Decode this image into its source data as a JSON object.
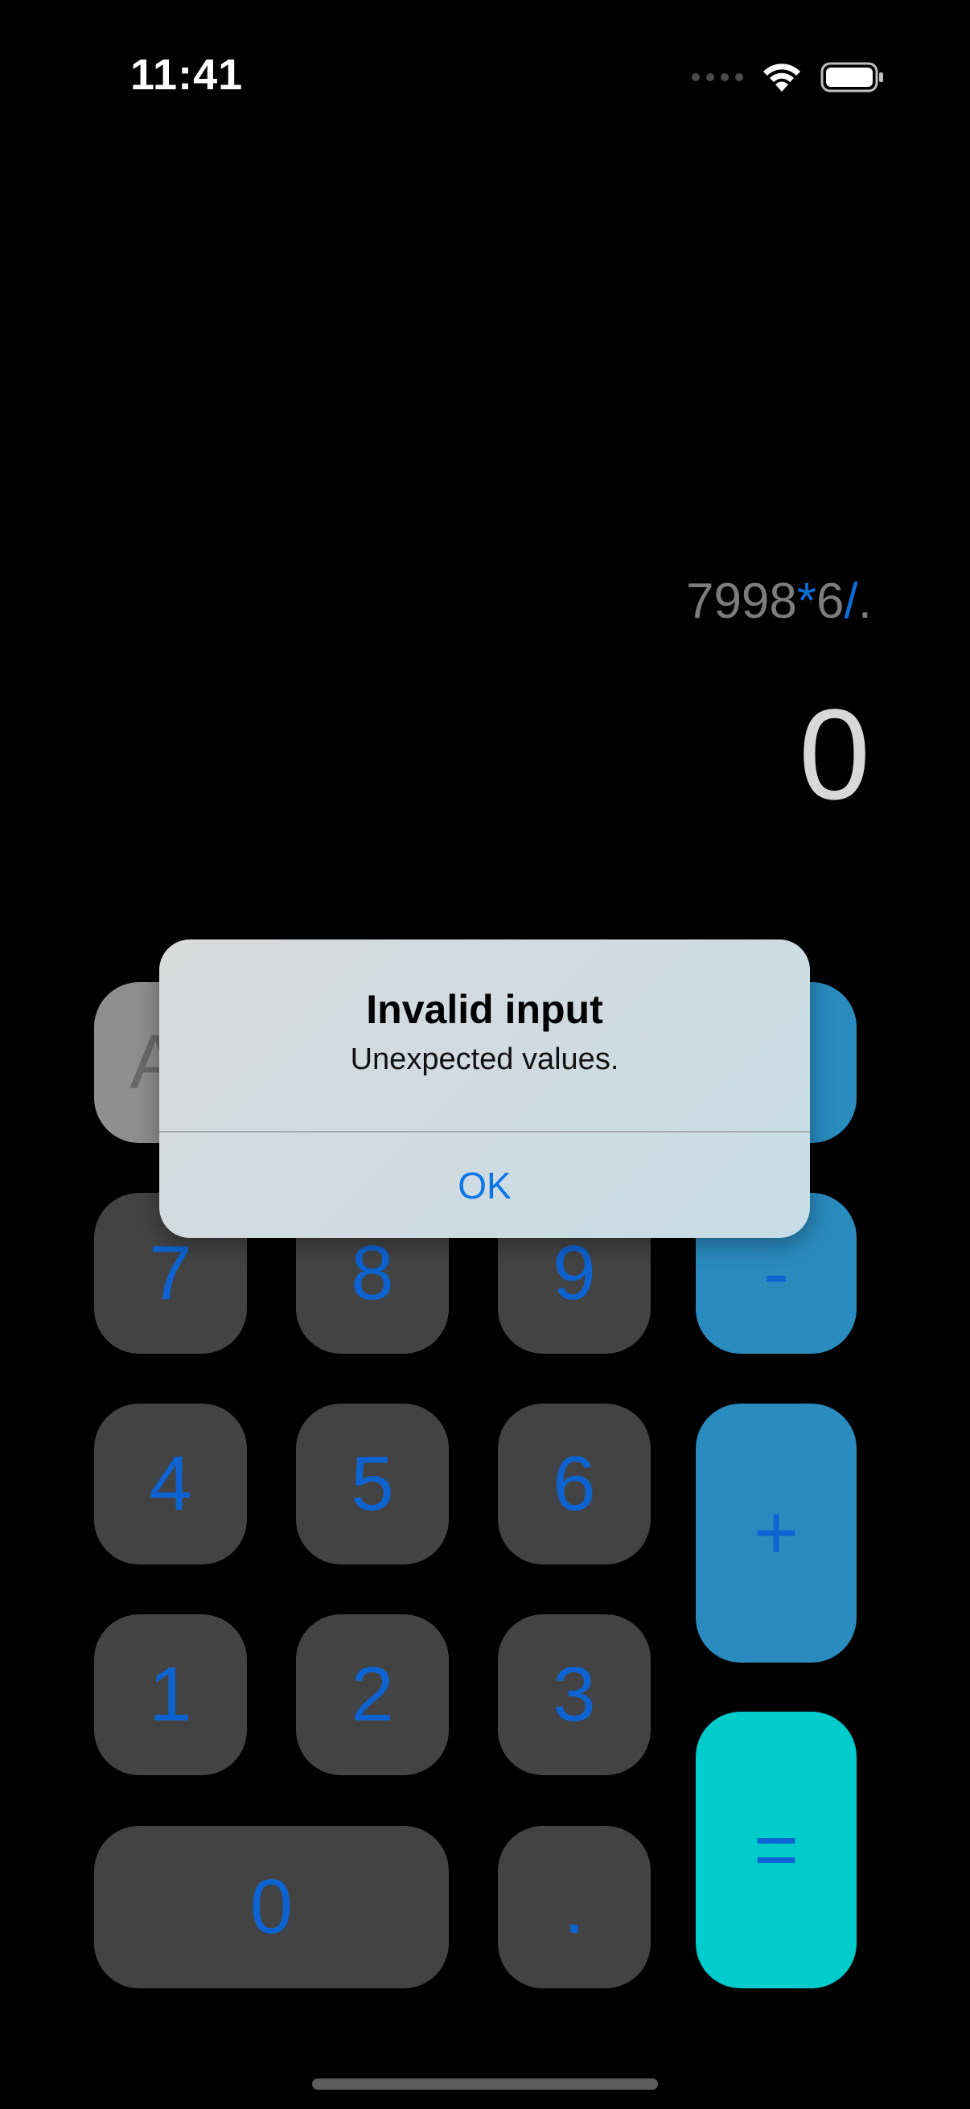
{
  "status_bar": {
    "time": "11:41",
    "icons": [
      "signal-dots-icon",
      "wifi-icon",
      "battery-icon"
    ]
  },
  "display": {
    "expression_parts": [
      "7998",
      "*",
      "6",
      "/",
      "."
    ],
    "result": "0"
  },
  "keypad": {
    "clear_label": "A",
    "minus": "-",
    "plus": "+",
    "equals": "=",
    "seven": "7",
    "eight": "8",
    "nine": "9",
    "four": "4",
    "five": "5",
    "six": "6",
    "one": "1",
    "two": "2",
    "three": "3",
    "zero": "0",
    "decimal": "."
  },
  "alert": {
    "title": "Invalid input",
    "message": "Unexpected values.",
    "ok_label": "OK"
  },
  "colors": {
    "background": "#000000",
    "digit_key": "#434343",
    "operator_key": "#2a8bbf",
    "equals_key": "#00cccc",
    "accent_text": "#0d63d1",
    "alert_button": "#0a75e6"
  }
}
